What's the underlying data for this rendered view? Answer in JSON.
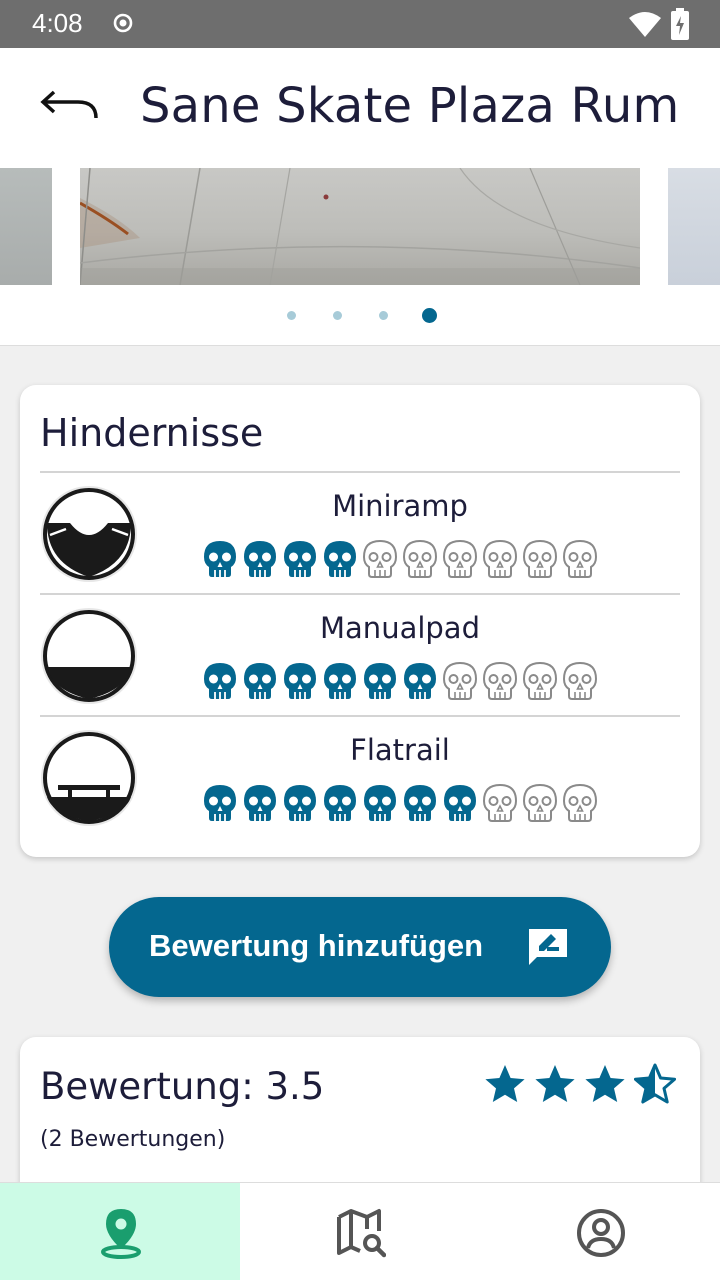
{
  "status": {
    "time": "4:08"
  },
  "header": {
    "title": "Sane Skate Plaza Rum",
    "back_icon": "arrow-back-icon"
  },
  "carousel": {
    "image_count": 4,
    "active_index": 3
  },
  "obstacles": {
    "title": "Hindernisse",
    "max_difficulty": 10,
    "items": [
      {
        "name": "Miniramp",
        "difficulty": 4,
        "icon": "miniramp-icon"
      },
      {
        "name": "Manualpad",
        "difficulty": 6,
        "icon": "manualpad-icon"
      },
      {
        "name": "Flatrail",
        "difficulty": 7,
        "icon": "flatrail-icon"
      }
    ]
  },
  "add_rating": {
    "label": "Bewertung hinzufügen",
    "icon": "rate-review-icon"
  },
  "rating": {
    "label": "Bewertung: 3.5",
    "value": 3.5,
    "count_text": "(2 Bewertungen)"
  },
  "nav": [
    {
      "icon": "location-pin-icon",
      "active": true
    },
    {
      "icon": "map-search-icon",
      "active": false
    },
    {
      "icon": "account-icon",
      "active": false
    }
  ],
  "colors": {
    "primary": "#04678f",
    "nav_active_bg": "#ccfbe6",
    "nav_active_icon": "#1a9e6e",
    "skull_inactive": "#8a8a8a"
  }
}
